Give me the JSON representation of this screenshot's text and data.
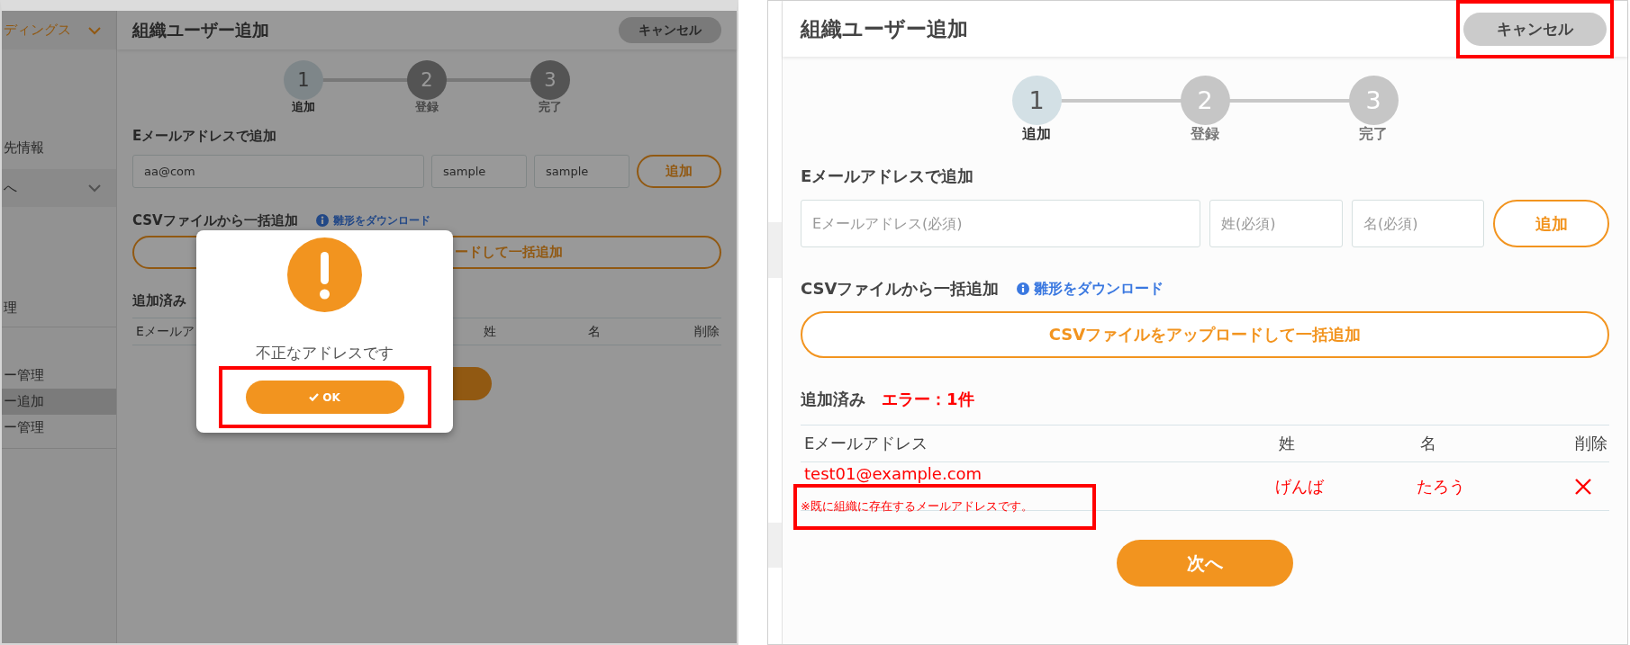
{
  "screens": [
    {
      "kind": "dialog_open",
      "sidebar": {
        "items": [
          {
            "label": "ディングス",
            "kind": "brand",
            "selected": false
          },
          {
            "label": "先情報",
            "kind": "link",
            "selected": false
          },
          {
            "label": "へ",
            "kind": "group",
            "selected": false
          },
          {
            "label": "理",
            "kind": "link",
            "selected": false
          },
          {
            "label": "ー管理",
            "kind": "link",
            "selected": false
          },
          {
            "label": "ー追加",
            "kind": "link",
            "selected": true
          },
          {
            "label": "ー管理",
            "kind": "link",
            "selected": false
          }
        ]
      },
      "title": "組織ユーザー追加",
      "cancel": {
        "label": "キャンセル"
      },
      "steps": [
        {
          "number": "1",
          "label": "追加",
          "current": true
        },
        {
          "number": "2",
          "label": "登録",
          "current": false
        },
        {
          "number": "3",
          "label": "完了",
          "current": false
        }
      ],
      "email_section": {
        "heading": "Eメールアドレスで追加",
        "fields": [
          {
            "value": "aa@com"
          },
          {
            "value": "sample"
          },
          {
            "value": "sample"
          }
        ],
        "add_button": "追加"
      },
      "csv_section": {
        "heading": "CSVファイルから一括追加",
        "template_link": "雛形をダウンロード",
        "upload_button": "ードして一括追加"
      },
      "added_section": {
        "heading": "追加済み",
        "columns": [
          "Eメールア",
          "姓",
          "名",
          "削除"
        ]
      },
      "dialog": {
        "message": "不正なアドレスです",
        "ok_button": {
          "label": "OK",
          "highlighted": true
        }
      }
    },
    {
      "kind": "error_list",
      "title": "組織ユーザー追加",
      "cancel": {
        "label": "キャンセル",
        "highlighted": true
      },
      "steps": [
        {
          "number": "1",
          "label": "追加",
          "current": true
        },
        {
          "number": "2",
          "label": "登録",
          "current": false
        },
        {
          "number": "3",
          "label": "完了",
          "current": false
        }
      ],
      "email_section": {
        "heading": "Eメールアドレスで追加",
        "fields": [
          {
            "placeholder": "Eメールアドレス(必須)"
          },
          {
            "placeholder": "姓(必須)"
          },
          {
            "placeholder": "名(必須)"
          }
        ],
        "add_button": "追加"
      },
      "csv_section": {
        "heading": "CSVファイルから一括追加",
        "template_link": "雛形をダウンロード",
        "upload_button": "CSVファイルをアップロードして一括追加"
      },
      "added_section": {
        "heading": "追加済み",
        "error_count": "エラー：1件",
        "columns": [
          "Eメールアドレス",
          "姓",
          "名",
          "削除"
        ],
        "rows": [
          {
            "email": "test01@example.com",
            "note": {
              "text": "※既に組織に存在するメールアドレスです。",
              "highlighted": true
            },
            "last_name": "げんば",
            "first_name": "たろう",
            "invalid": true
          }
        ]
      },
      "next_button": "次へ"
    }
  ]
}
